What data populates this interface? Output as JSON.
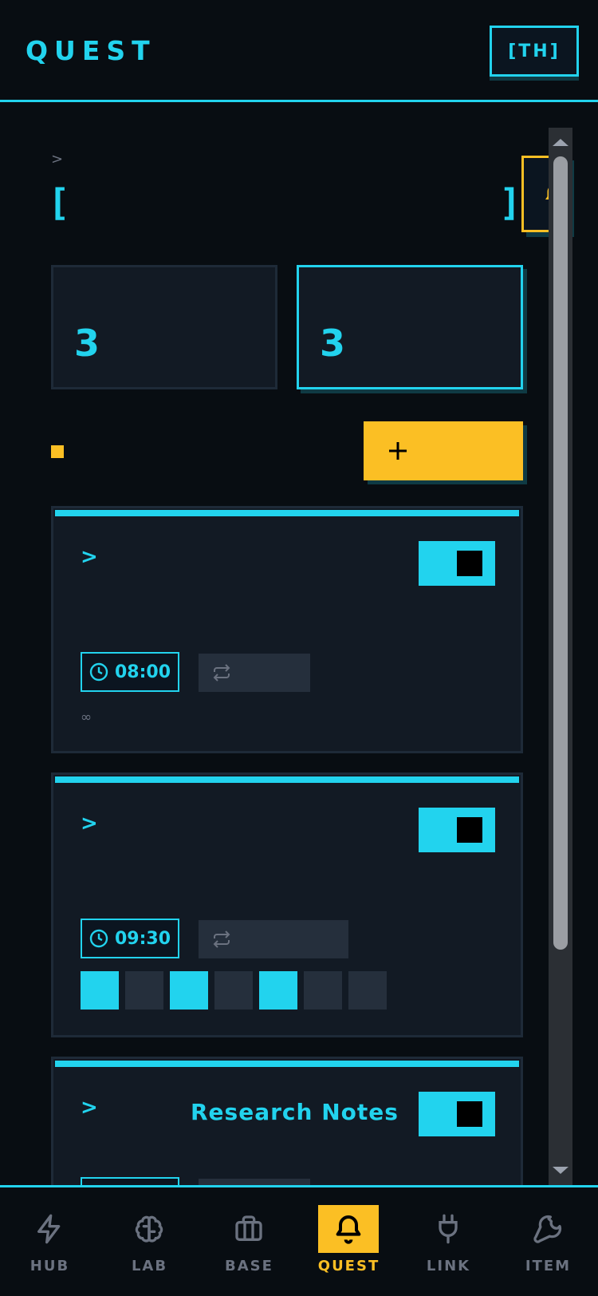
{
  "header": {
    "title": "QUEST",
    "lang_label": "[TH]"
  },
  "main": {
    "breadcrumb": ">",
    "bracket_open": "[",
    "bracket_close": "]",
    "stats": [
      {
        "value": "3"
      },
      {
        "value": "3"
      }
    ],
    "alarms": [
      {
        "chevron": ">",
        "label": "",
        "time": "08:00",
        "enabled": true,
        "repeat_note": "∞"
      },
      {
        "chevron": ">",
        "label": "",
        "time": "09:30",
        "enabled": true,
        "days": [
          true,
          false,
          true,
          false,
          true,
          false,
          false
        ]
      },
      {
        "chevron": ">",
        "label": "Research Notes",
        "time": "",
        "enabled": true
      }
    ]
  },
  "nav": {
    "items": [
      {
        "label": "HUB",
        "icon": "lightning-icon"
      },
      {
        "label": "LAB",
        "icon": "brain-icon"
      },
      {
        "label": "BASE",
        "icon": "briefcase-icon"
      },
      {
        "label": "QUEST",
        "icon": "bell-icon",
        "active": true
      },
      {
        "label": "LINK",
        "icon": "plug-icon"
      },
      {
        "label": "ITEM",
        "icon": "wrench-icon"
      }
    ]
  },
  "colors": {
    "accent": "#22d3ee",
    "highlight": "#fbbf24",
    "background": "#080d12",
    "card": "#121a24"
  }
}
